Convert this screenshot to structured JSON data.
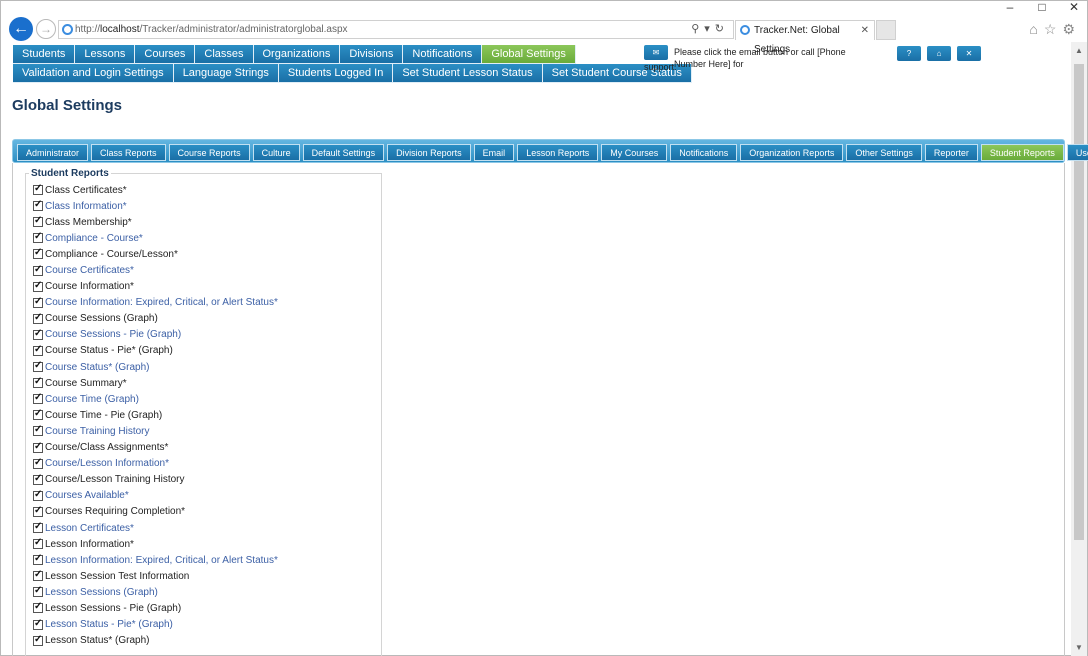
{
  "browser": {
    "url_prefix": "http://",
    "url_host": "localhost",
    "url_path": "/Tracker/administrator/administratorglobal.aspx",
    "tab_title": "Tracker.Net: Global Settings",
    "window_controls": [
      "–",
      "□",
      "✕"
    ]
  },
  "top_nav": {
    "row1": [
      "Students",
      "Lessons",
      "Courses",
      "Classes",
      "Organizations",
      "Divisions",
      "Notifications",
      "Global Settings"
    ],
    "row2": [
      "Validation and Login Settings",
      "Language Strings",
      "Students Logged In",
      "Set Student Lesson Status",
      "Set Student Course Status"
    ],
    "active": "Global Settings"
  },
  "support": {
    "message": "Please click the email button or call [Phone Number Here] for",
    "message_line2": "support.",
    "email_icon": "✉",
    "help_label": "?",
    "home_label": "⌂",
    "close_label": "✕"
  },
  "page_title": "Global Settings",
  "settings_tabs": [
    "Administrator",
    "Class Reports",
    "Course Reports",
    "Culture",
    "Default Settings",
    "Division Reports",
    "Email",
    "Lesson Reports",
    "My Courses",
    "Notifications",
    "Organization Reports",
    "Other Settings",
    "Reporter",
    "Student Reports",
    "User Interface"
  ],
  "active_settings_tab": "Student Reports",
  "student_reports": {
    "legend": "Student Reports",
    "items": [
      {
        "label": "Class Certificates*",
        "checked": true,
        "blue": false
      },
      {
        "label": "Class Information*",
        "checked": true,
        "blue": true
      },
      {
        "label": "Class Membership*",
        "checked": true,
        "blue": false
      },
      {
        "label": "Compliance - Course*",
        "checked": true,
        "blue": true
      },
      {
        "label": "Compliance - Course/Lesson*",
        "checked": true,
        "blue": false
      },
      {
        "label": "Course Certificates*",
        "checked": true,
        "blue": true
      },
      {
        "label": "Course Information*",
        "checked": true,
        "blue": false
      },
      {
        "label": "Course Information: Expired, Critical, or Alert Status*",
        "checked": true,
        "blue": true
      },
      {
        "label": "Course Sessions (Graph)",
        "checked": true,
        "blue": false
      },
      {
        "label": "Course Sessions - Pie (Graph)",
        "checked": true,
        "blue": true
      },
      {
        "label": "Course Status - Pie* (Graph)",
        "checked": true,
        "blue": false
      },
      {
        "label": "Course Status* (Graph)",
        "checked": true,
        "blue": true
      },
      {
        "label": "Course Summary*",
        "checked": true,
        "blue": false
      },
      {
        "label": "Course Time (Graph)",
        "checked": true,
        "blue": true
      },
      {
        "label": "Course Time - Pie (Graph)",
        "checked": true,
        "blue": false
      },
      {
        "label": "Course Training History",
        "checked": true,
        "blue": true
      },
      {
        "label": "Course/Class Assignments*",
        "checked": true,
        "blue": false
      },
      {
        "label": "Course/Lesson Information*",
        "checked": true,
        "blue": true
      },
      {
        "label": "Course/Lesson Training History",
        "checked": true,
        "blue": false
      },
      {
        "label": "Courses Available*",
        "checked": true,
        "blue": true
      },
      {
        "label": "Courses Requiring Completion*",
        "checked": true,
        "blue": false
      },
      {
        "label": "Lesson Certificates*",
        "checked": true,
        "blue": true
      },
      {
        "label": "Lesson Information*",
        "checked": true,
        "blue": false
      },
      {
        "label": "Lesson Information: Expired, Critical, or Alert Status*",
        "checked": true,
        "blue": true
      },
      {
        "label": "Lesson Session Test Information",
        "checked": true,
        "blue": false
      },
      {
        "label": "Lesson Sessions (Graph)",
        "checked": true,
        "blue": true
      },
      {
        "label": "Lesson Sessions - Pie (Graph)",
        "checked": true,
        "blue": false
      },
      {
        "label": "Lesson Status - Pie* (Graph)",
        "checked": true,
        "blue": true
      },
      {
        "label": "Lesson Status* (Graph)",
        "checked": true,
        "blue": false
      }
    ]
  },
  "colors": {
    "nav_blue": "#1f7db6",
    "nav_active_green": "#7dbb4a",
    "title_navy": "#1c3b5f",
    "link_blue": "#3b5fa5"
  }
}
